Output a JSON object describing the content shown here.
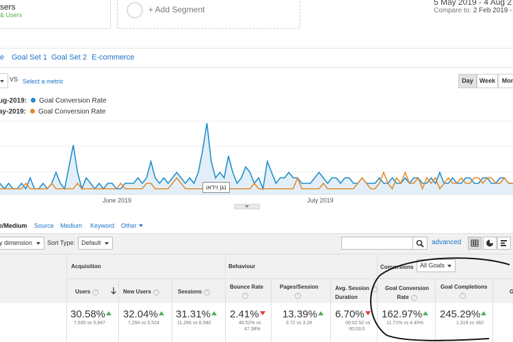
{
  "segments": {
    "current_name": "sers",
    "current_sub": "& Users",
    "add_label": "+ Add Segment"
  },
  "date_range": {
    "range": "5 May 2019 - 4 Aug 2",
    "compare_prefix": "Compare to:",
    "compare_value": "2 Feb 2019 -"
  },
  "tabs": [
    "e",
    "Goal Set 1",
    "Goal Set 2",
    "E-commerce"
  ],
  "metric_bar": {
    "vs": "VS",
    "select_metric": "Select a metric",
    "day": "Day",
    "week": "Week",
    "month": "Mon"
  },
  "legend": [
    {
      "prefix": "ug-2019:",
      "name": "Goal Conversion Rate",
      "color": "#1f8dc8"
    },
    {
      "prefix": "ay-2019:",
      "name": "Goal Conversion Rate",
      "color": "#e08a2c"
    }
  ],
  "chart_data": {
    "type": "line",
    "x_labels": [
      "June 2019",
      "July 2019"
    ],
    "series": [
      {
        "color": "#1f8dc8",
        "values": [
          2,
          1,
          2,
          1,
          1,
          2,
          1,
          3,
          1,
          1,
          2,
          1,
          2,
          4,
          2,
          1,
          5,
          9,
          4,
          1,
          3,
          2,
          1,
          2,
          1,
          2,
          2,
          1,
          1,
          2,
          2,
          2,
          3,
          2,
          3,
          6,
          3,
          2,
          3,
          2,
          3,
          4,
          3,
          2,
          3,
          2,
          4,
          8,
          13,
          6,
          3,
          4,
          3,
          7,
          4,
          2,
          3,
          5,
          4,
          2,
          3,
          1,
          6,
          4,
          2,
          3,
          3,
          4,
          3,
          3,
          2,
          2,
          2,
          3,
          4,
          3,
          2,
          3,
          3,
          2,
          3,
          3,
          2,
          2,
          3,
          2,
          2,
          2,
          3,
          2,
          2,
          3,
          2,
          2,
          3,
          2,
          3,
          3,
          2,
          2,
          3,
          2,
          4,
          2,
          2,
          3,
          2,
          2,
          3,
          3,
          2,
          2,
          3,
          3,
          2,
          2,
          3,
          3,
          2,
          2
        ]
      },
      {
        "color": "#e08a2c",
        "values": [
          1,
          1,
          1,
          1,
          1,
          1,
          2,
          1,
          1,
          1,
          1,
          1,
          2,
          1,
          1,
          1,
          1,
          1,
          2,
          1,
          1,
          1,
          1,
          1,
          1,
          1,
          1,
          1,
          2,
          1,
          1,
          1,
          1,
          1,
          2,
          2,
          1,
          1,
          1,
          1,
          2,
          3,
          2,
          1,
          1,
          1,
          1,
          1,
          1,
          1,
          2,
          2,
          1,
          1,
          1,
          1,
          1,
          1,
          1,
          2,
          1,
          1,
          1,
          1,
          1,
          1,
          1,
          1,
          1,
          3,
          1,
          1,
          1,
          1,
          1,
          2,
          1,
          1,
          1,
          1,
          1,
          1,
          1,
          2,
          3,
          2,
          1,
          1,
          2,
          4,
          2,
          1,
          3,
          2,
          4,
          2,
          2,
          3,
          1,
          3,
          2,
          3,
          1,
          2,
          3,
          2,
          2,
          3,
          2,
          2,
          3,
          3,
          2,
          3,
          3,
          2,
          2,
          3,
          2,
          2
        ]
      }
    ],
    "tooltip": "נגן וידאו"
  },
  "dimensions": {
    "primary": "e/Medium",
    "items": [
      "Source",
      "Medium",
      "Keyword",
      "Other"
    ]
  },
  "toolbar": {
    "secondary": "y dimension",
    "sort_label": "Sort Type:",
    "sort_value": "Default",
    "advanced": "advanced"
  },
  "table": {
    "groups": {
      "acquisition": "Acquisition",
      "behaviour": "Behaviour",
      "conversions": "Conversions",
      "goal_select": "All Goals"
    },
    "columns": [
      {
        "label": "Users",
        "value": "30.58%",
        "trend": "up",
        "compare": "7,635 vs 5,847"
      },
      {
        "label": "New Users",
        "value": "32.04%",
        "trend": "up",
        "compare": "7,294 vs 5,524"
      },
      {
        "label": "Sessions",
        "value": "31.31%",
        "trend": "up",
        "compare": "11,266 vs 8,580"
      },
      {
        "label": "Bounce Rate",
        "value": "2.41%",
        "trend": "down",
        "compare": "48.52% vs",
        "compare2": "47.38%"
      },
      {
        "label": "Pages/Session",
        "value": "13.39%",
        "trend": "up",
        "compare": "3.72 vs 3.28"
      },
      {
        "label": "Avg. Session",
        "label2": "Duration",
        "value": "6.70%",
        "trend": "down",
        "compare": "00:02:52 vs",
        "compare2": "00:03:0"
      },
      {
        "label": "Goal Conversion",
        "label2": "Rate",
        "value": "162.97%",
        "trend": "up",
        "compare": "11.71% vs 4.45%"
      },
      {
        "label": "Goal Completions",
        "value": "245.29%",
        "trend": "up",
        "compare": "1,319 vs 382"
      },
      {
        "label": "G"
      }
    ]
  }
}
